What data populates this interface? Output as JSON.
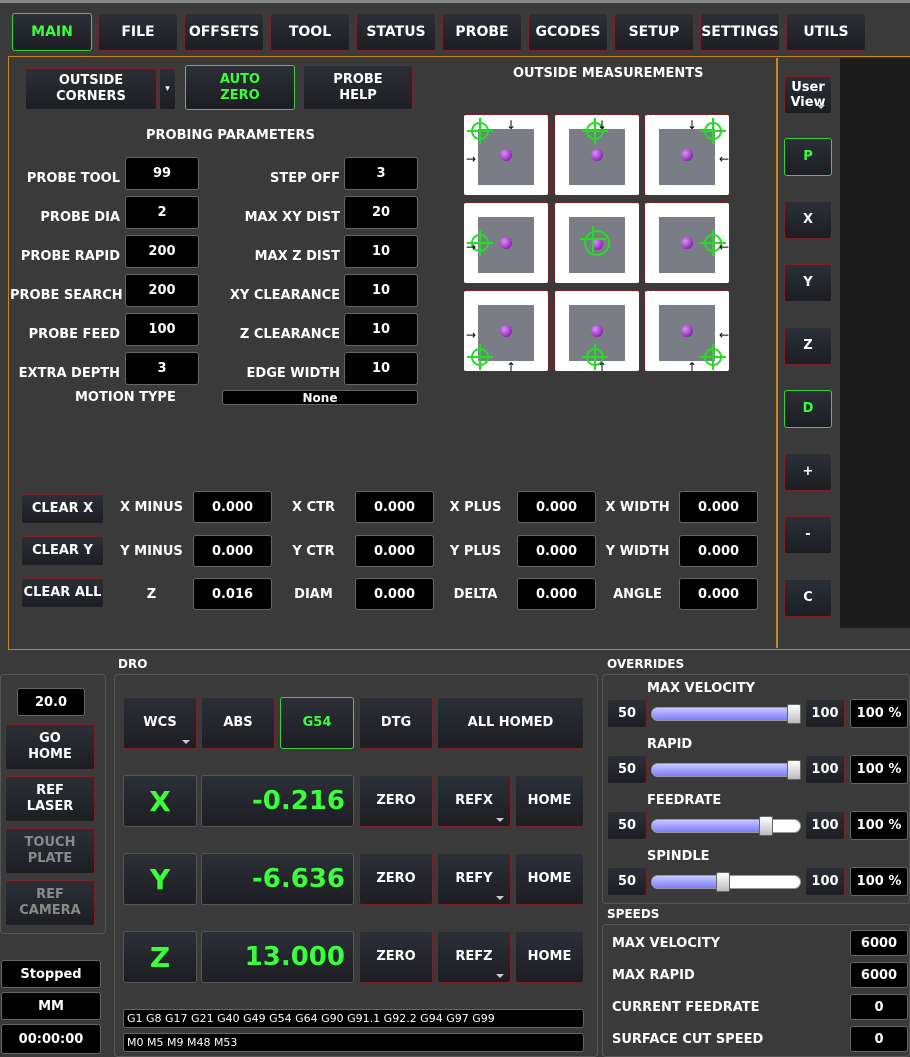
{
  "tabs": [
    "MAIN",
    "FILE",
    "OFFSETS",
    "TOOL",
    "STATUS",
    "PROBE",
    "GCODES",
    "SETUP",
    "SETTINGS",
    "UTILS"
  ],
  "probe": {
    "mode": "OUTSIDE CORNERS",
    "auto_zero": "AUTO\nZERO",
    "probe_help": "PROBE\nHELP",
    "params_title": "PROBING PARAMETERS",
    "measure_title": "OUTSIDE MEASUREMENTS",
    "left_params": [
      {
        "label": "PROBE TOOL",
        "value": "99"
      },
      {
        "label": "PROBE DIA",
        "value": "2"
      },
      {
        "label": "PROBE RAPID",
        "value": "200"
      },
      {
        "label": "PROBE SEARCH",
        "value": "200"
      },
      {
        "label": "PROBE FEED",
        "value": "100"
      },
      {
        "label": "EXTRA DEPTH",
        "value": "3"
      }
    ],
    "right_params": [
      {
        "label": "STEP OFF",
        "value": "3"
      },
      {
        "label": "MAX XY DIST",
        "value": "20"
      },
      {
        "label": "MAX Z DIST",
        "value": "10"
      },
      {
        "label": "XY CLEARANCE",
        "value": "10"
      },
      {
        "label": "Z CLEARANCE",
        "value": "10"
      },
      {
        "label": "EDGE WIDTH",
        "value": "10"
      }
    ],
    "motion_type_label": "MOTION TYPE",
    "motion_type_value": "None",
    "clear_x": "CLEAR X",
    "clear_y": "CLEAR Y",
    "clear_all": "CLEAR ALL",
    "results": [
      [
        {
          "label": "X MINUS",
          "value": "0.000"
        },
        {
          "label": "X CTR",
          "value": "0.000"
        },
        {
          "label": "X PLUS",
          "value": "0.000"
        },
        {
          "label": "X WIDTH",
          "value": "0.000"
        }
      ],
      [
        {
          "label": "Y MINUS",
          "value": "0.000"
        },
        {
          "label": "Y CTR",
          "value": "0.000"
        },
        {
          "label": "Y PLUS",
          "value": "0.000"
        },
        {
          "label": "Y WIDTH",
          "value": "0.000"
        }
      ],
      [
        {
          "label": "Z",
          "value": "0.016"
        },
        {
          "label": "DIAM",
          "value": "0.000"
        },
        {
          "label": "DELTA",
          "value": "0.000"
        },
        {
          "label": "ANGLE",
          "value": "0.000"
        }
      ]
    ]
  },
  "view_side": {
    "user_view": "User\nView",
    "buttons": [
      "P",
      "X",
      "Y",
      "Z",
      "D",
      "+",
      "-",
      "C"
    ]
  },
  "left_col": {
    "value": "20.0",
    "go_home": "GO\nHOME",
    "ref_laser": "REF\nLASER",
    "touch_plate": "TOUCH\nPLATE",
    "ref_camera": "REF\nCAMERA",
    "status": "Stopped",
    "units": "MM",
    "timer": "00:00:00"
  },
  "dro": {
    "title": "DRO",
    "wcs": "WCS",
    "abs": "ABS",
    "g54": "G54",
    "dtg": "DTG",
    "homed": "ALL HOMED",
    "axes": [
      {
        "name": "X",
        "value": "-0.216",
        "zero": "ZERO",
        "ref": "REFX",
        "home": "HOME"
      },
      {
        "name": "Y",
        "value": "-6.636",
        "zero": "ZERO",
        "ref": "REFY",
        "home": "HOME"
      },
      {
        "name": "Z",
        "value": "13.000",
        "zero": "ZERO",
        "ref": "REFZ",
        "home": "HOME"
      }
    ],
    "gcodes": "G1 G8 G17 G21 G40 G49 G54 G64 G90 G91.1 G92.2 G94 G97 G99",
    "mcodes": "M0 M5 M9 M48 M53"
  },
  "overrides": {
    "title": "OVERRIDES",
    "rows": [
      {
        "label": "MAX VELOCITY",
        "min": "50",
        "max": "100",
        "pct": "100 %",
        "level": 1.0
      },
      {
        "label": "RAPID",
        "min": "50",
        "max": "100",
        "pct": "100 %",
        "level": 1.0
      },
      {
        "label": "FEEDRATE",
        "min": "50",
        "max": "100",
        "pct": "100 %",
        "level": 0.8
      },
      {
        "label": "SPINDLE",
        "min": "50",
        "max": "100",
        "pct": "100 %",
        "level": 0.5
      }
    ]
  },
  "speeds": {
    "title": "SPEEDS",
    "rows": [
      {
        "label": "MAX VELOCITY",
        "value": "6000"
      },
      {
        "label": "MAX RAPID",
        "value": "6000"
      },
      {
        "label": "CURRENT FEEDRATE",
        "value": "0"
      },
      {
        "label": "SURFACE CUT SPEED",
        "value": "0"
      }
    ]
  },
  "colors": {
    "accent_green": "#3aff3a",
    "border_red": "#7a2028",
    "frame_orange": "#c8871e"
  }
}
